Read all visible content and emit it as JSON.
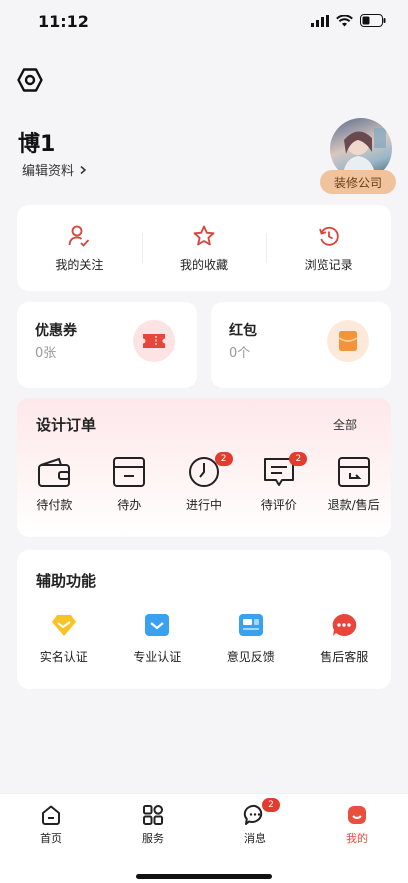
{
  "status": {
    "time": "11:12"
  },
  "profile": {
    "name": "博1",
    "edit_label": "编辑资料",
    "company_badge": "装修公司"
  },
  "shortcuts": [
    {
      "label": "我的关注",
      "icon": "person-check-icon"
    },
    {
      "label": "我的收藏",
      "icon": "star-icon"
    },
    {
      "label": "浏览记录",
      "icon": "history-icon"
    }
  ],
  "wallet": {
    "coupon": {
      "title": "优惠券",
      "value": "0张",
      "icon": "ticket-icon"
    },
    "redpacket": {
      "title": "红包",
      "value": "0个",
      "icon": "red-envelope-icon"
    }
  },
  "orders": {
    "title": "设计订单",
    "all_label": "全部",
    "items": [
      {
        "label": "待付款",
        "icon": "wallet-icon",
        "badge": ""
      },
      {
        "label": "待办",
        "icon": "inbox-icon",
        "badge": ""
      },
      {
        "label": "进行中",
        "icon": "clock-icon",
        "badge": "2"
      },
      {
        "label": "待评价",
        "icon": "comment-icon",
        "badge": "2"
      },
      {
        "label": "退款/售后",
        "icon": "refund-icon",
        "badge": ""
      }
    ]
  },
  "assist": {
    "title": "辅助功能",
    "items": [
      {
        "label": "实名认证",
        "icon": "diamond-icon"
      },
      {
        "label": "专业认证",
        "icon": "mail-check-icon"
      },
      {
        "label": "意见反馈",
        "icon": "feedback-card-icon"
      },
      {
        "label": "售后客服",
        "icon": "chat-bubble-icon"
      }
    ]
  },
  "tabs": [
    {
      "label": "首页",
      "icon": "home-icon",
      "badge": ""
    },
    {
      "label": "服务",
      "icon": "grid-icon",
      "badge": ""
    },
    {
      "label": "消息",
      "icon": "message-icon",
      "badge": "2"
    },
    {
      "label": "我的",
      "icon": "profile-icon",
      "badge": ""
    }
  ],
  "colors": {
    "accent": "#e94f3c",
    "badge": "#e33b2e",
    "icon_red": "#d9433a",
    "company_badge_bg": "#f1c39d"
  }
}
